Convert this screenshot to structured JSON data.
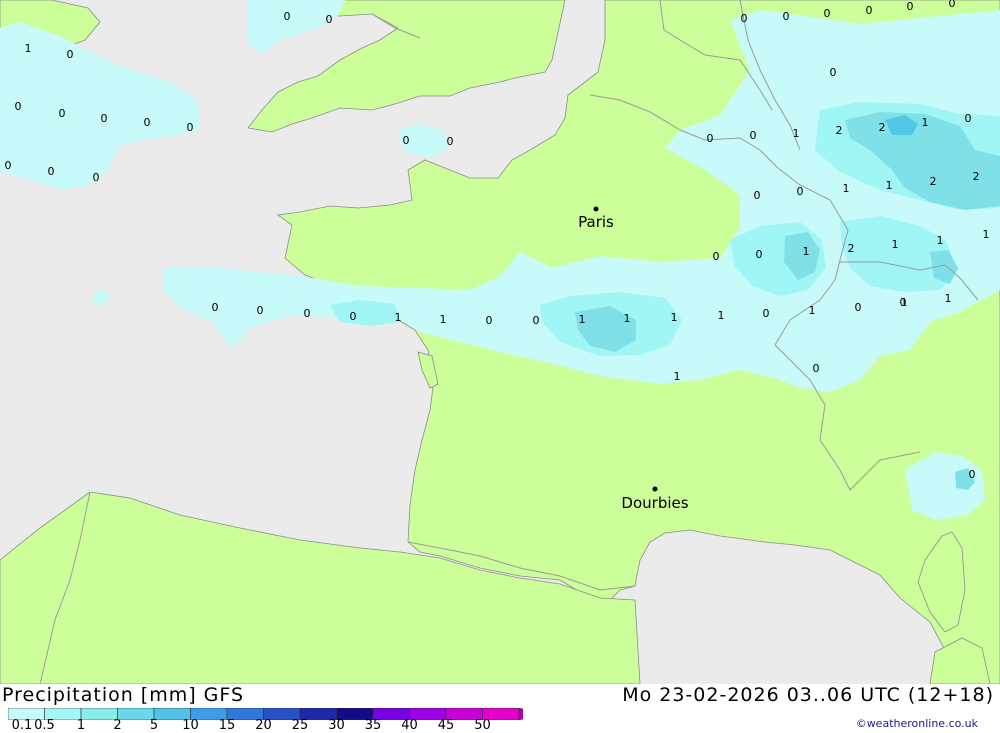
{
  "header": {
    "legend_title": "Precipitation [mm] GFS",
    "run_time": "Mo 23-02-2026 03..06 UTC (12+18)",
    "credit": "©weatheronline.co.uk"
  },
  "colors": {
    "sea": "#ebebeb",
    "land": "#ccff99",
    "precip_light": "#c8fafa",
    "precip_mid": "#a0f5f5",
    "precip_heavy": "#80e0e8",
    "precip_max": "#50c8e6",
    "border": "#9a9a9a"
  },
  "scale": {
    "labels": [
      "0.1",
      "0.5",
      "1",
      "2",
      "5",
      "10",
      "15",
      "20",
      "25",
      "30",
      "35",
      "40",
      "45",
      "50"
    ],
    "colors": [
      "#c8fafa",
      "#a6f5f5",
      "#8aebeb",
      "#6ad7eb",
      "#50c3e6",
      "#3c9ee6",
      "#3278dc",
      "#2850c8",
      "#1e28aa",
      "#140a8c",
      "#7800e6",
      "#a000e6",
      "#c800dc",
      "#e600cc",
      "#b400b4"
    ]
  },
  "cities": [
    {
      "name": "Paris"
    },
    {
      "name": "Dourbies"
    }
  ],
  "values": [
    "1",
    "0",
    "0",
    "0",
    "0",
    "0",
    "0",
    "0",
    "0",
    "0",
    "0",
    "0",
    "0",
    "0",
    "0",
    "0",
    "0",
    "0",
    "0",
    "0",
    "0",
    "0",
    "0",
    "1",
    "2",
    "2",
    "1",
    "0",
    "0",
    "0",
    "1",
    "1",
    "2",
    "2",
    "0",
    "0",
    "1",
    "2",
    "1",
    "1",
    "1",
    "0",
    "0",
    "0",
    "0",
    "1",
    "1",
    "0",
    "0",
    "1",
    "1",
    "1",
    "1",
    "0",
    "1",
    "0",
    "0",
    "1",
    "1",
    "0",
    "0",
    "1"
  ]
}
